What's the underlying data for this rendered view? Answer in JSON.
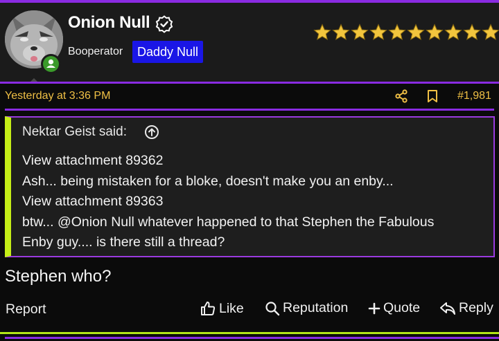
{
  "post": {
    "author": {
      "name": "Onion Null",
      "title": "Booperator",
      "badge": "Daddy Null",
      "stars": 10
    },
    "date": "Yesterday at 3:36 PM",
    "number": "#1,981",
    "quote": {
      "header": "Nektar Geist said:",
      "lines": [
        "View attachment 89362",
        "Ash... being mistaken for a bloke, doesn't make you an enby...",
        "View attachment 89363",
        "btw... @Onion Null whatever happened to that Stephen the Fabulous",
        "Enby guy.... is there still a thread?"
      ]
    },
    "body": "Stephen who?",
    "actions": {
      "report": "Report",
      "like": "Like",
      "reputation": "Reputation",
      "quote": "Quote",
      "reply": "Reply"
    }
  },
  "colors": {
    "accent": "#8a2be2",
    "date": "#f0c045",
    "badge_bg": "#1a16e6",
    "quote_bar": "#c5ee17",
    "online": "#3a9a2a",
    "star": "#f2c53d"
  },
  "icons": [
    "verified-badge-icon",
    "online-user-icon",
    "star-icon",
    "share-icon",
    "bookmark-icon",
    "arrow-up-circle-icon",
    "like-icon",
    "search-icon",
    "plus-icon",
    "reply-icon"
  ]
}
